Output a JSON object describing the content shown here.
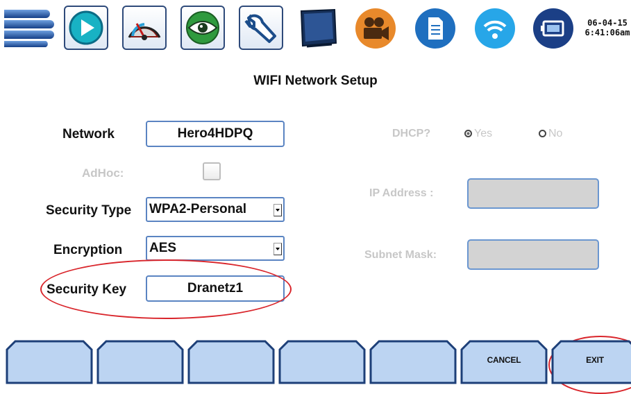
{
  "toolbar": {
    "icons": [
      "menu-icon",
      "play-icon",
      "meter-icon",
      "eye-icon",
      "wrench-icon",
      "monitor-icon",
      "camera-icon",
      "document-icon",
      "wifi-icon",
      "battery-icon"
    ],
    "date": "06-04-15",
    "time": "6:41:06am"
  },
  "title": "WIFI Network Setup",
  "form": {
    "network_label": "Network",
    "network_value": "Hero4HDPQ",
    "adhoc_label": "AdHoc:",
    "adhoc_checked": false,
    "security_type_label": "Security Type",
    "security_type_value": "WPA2-Personal",
    "encryption_label": "Encryption",
    "encryption_value": "AES",
    "security_key_label": "Security Key",
    "security_key_value": "Dranetz1"
  },
  "ip_settings": {
    "dhcp_label": "DHCP?",
    "yes_label": "Yes",
    "no_label": "No",
    "ip_address_label": "IP Address :",
    "ip_address_value": "",
    "subnet_mask_label": "Subnet Mask:",
    "subnet_mask_value": ""
  },
  "softkeys": [
    "",
    "",
    "",
    "",
    "",
    "CANCEL",
    "EXIT"
  ],
  "colors": {
    "field_border": "#5a84c2",
    "highlight": "#d9252b",
    "disabled_text": "#c7c7c7",
    "toolbar_blue": "#1f5fae",
    "camera_orange": "#e8892b"
  }
}
